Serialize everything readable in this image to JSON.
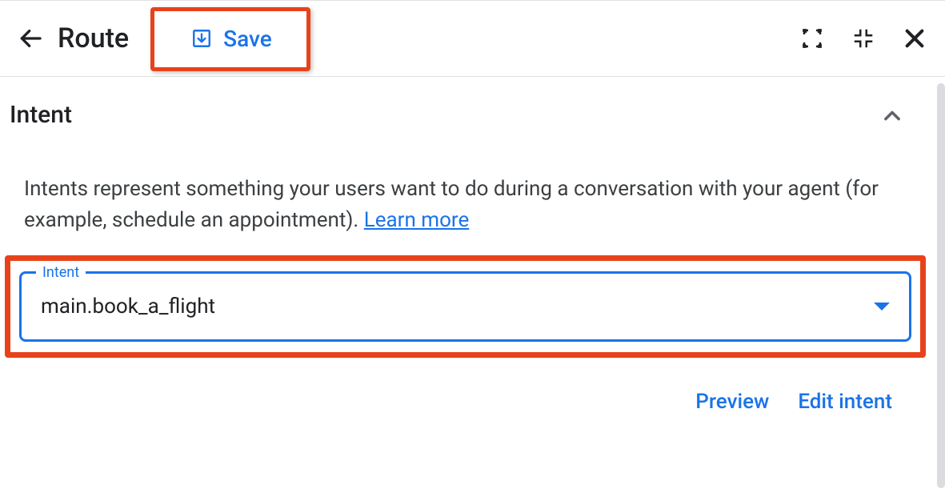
{
  "header": {
    "title": "Route",
    "save_label": "Save"
  },
  "section": {
    "title": "Intent",
    "description_prefix": "Intents represent something your users want to do during a conversation with your agent (for example, schedule an appointment). ",
    "learn_more": "Learn more"
  },
  "field": {
    "label": "Intent",
    "value": "main.book_a_flight"
  },
  "actions": {
    "preview": "Preview",
    "edit_intent": "Edit intent"
  }
}
